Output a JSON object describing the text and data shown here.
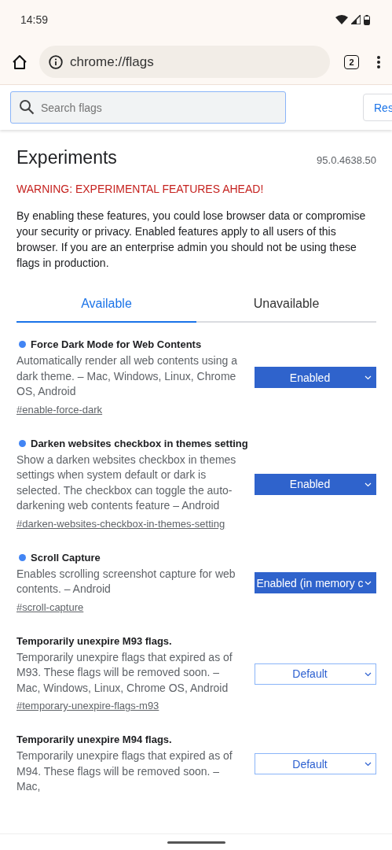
{
  "status_bar": {
    "time": "14:59"
  },
  "toolbar": {
    "url": "chrome://flags",
    "tab_count": "2"
  },
  "search": {
    "placeholder": "Search flags",
    "reset_button": "Res"
  },
  "header": {
    "title": "Experiments",
    "version": "95.0.4638.50",
    "warning": "WARNING: EXPERIMENTAL FEATURES AHEAD!",
    "intro": "By enabling these features, you could lose browser data or compromise your security or privacy. Enabled features apply to all users of this browser. If you are an enterprise admin you should not be using these flags in production."
  },
  "tabs": [
    {
      "label": "Available",
      "selected": true
    },
    {
      "label": "Unavailable",
      "selected": false
    }
  ],
  "flags": [
    {
      "name": "Force Dark Mode for Web Contents",
      "modified": true,
      "description": "Automatically render all web contents using a dark theme. – Mac, Windows, Linux, Chrome OS, Android",
      "link": "#enable-force-dark",
      "value": "Enabled"
    },
    {
      "name": "Darken websites checkbox in themes setting",
      "modified": true,
      "description": "Show a darken websites checkbox in themes settings when system default or dark is selected. The checkbox can toggle the auto-darkening web contents feature – Android",
      "link": "#darken-websites-checkbox-in-themes-setting",
      "value": "Enabled"
    },
    {
      "name": "Scroll Capture",
      "modified": true,
      "description": "Enables scrolling screenshot capture for web contents. – Android",
      "link": "#scroll-capture",
      "value": "Enabled (in memory c"
    },
    {
      "name": "Temporarily unexpire M93 flags.",
      "modified": false,
      "description": "Temporarily unexpire flags that expired as of M93. These flags will be removed soon. – Mac, Windows, Linux, Chrome OS, Android",
      "link": "#temporary-unexpire-flags-m93",
      "value": "Default"
    },
    {
      "name": "Temporarily unexpire M94 flags.",
      "modified": false,
      "description": "Temporarily unexpire flags that expired as of M94. These flags will be removed soon. – Mac,",
      "value": "Default"
    }
  ]
}
